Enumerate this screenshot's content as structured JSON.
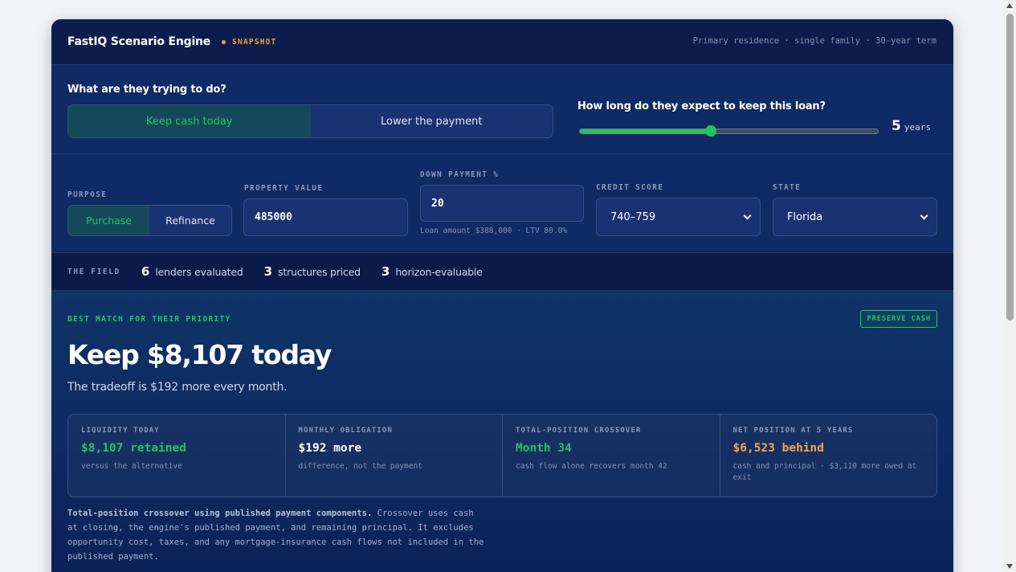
{
  "header": {
    "brand": "FastIQ Scenario Engine",
    "snapshot": "SNAPSHOT",
    "meta": "Primary residence · single family · 30-year term"
  },
  "intent": {
    "question": "What are they trying to do?",
    "options": [
      "Keep cash today",
      "Lower the payment"
    ],
    "selected": "Keep cash today",
    "horizon_question": "How long do they expect to keep this loan?",
    "horizon_value": "5",
    "horizon_unit": "years",
    "horizon_fraction": 0.44
  },
  "inputs": {
    "purpose_label": "PURPOSE",
    "purpose_options": [
      "Purchase",
      "Refinance"
    ],
    "purpose_selected": "Purchase",
    "property_label": "PROPERTY VALUE",
    "property_value": "485000",
    "down_label": "DOWN PAYMENT %",
    "down_value": "20",
    "down_note": "Loan amount $388,000 · LTV 80.0%",
    "credit_label": "CREDIT SCORE",
    "credit_value": "740–759",
    "state_label": "STATE",
    "state_value": "Florida"
  },
  "field": {
    "tag": "THE FIELD",
    "stats": [
      {
        "num": "6",
        "text": "lenders evaluated"
      },
      {
        "num": "3",
        "text": "structures priced"
      },
      {
        "num": "3",
        "text": "horizon-evaluable"
      }
    ]
  },
  "result": {
    "tag": "BEST MATCH FOR THEIR PRIORITY",
    "badge": "PRESERVE CASH",
    "headline": "Keep $8,107 today",
    "subline": "The tradeoff is $192 more every month.",
    "metrics": [
      {
        "label": "LIQUIDITY TODAY",
        "value": "$8,107 retained",
        "sub": "versus the alternative",
        "color": "#22c55e"
      },
      {
        "label": "MONTHLY OBLIGATION",
        "value": "$192 more",
        "sub": "difference, not the payment",
        "color": "#ffffff"
      },
      {
        "label": "TOTAL-POSITION CROSSOVER",
        "value": "Month 34",
        "sub": "cash flow alone recovers month 42",
        "color": "#22c55e"
      },
      {
        "label": "NET POSITION AT 5 YEARS",
        "value": "$6,523 behind",
        "sub": "cash and principal · $3,110 more owed at exit",
        "color": "#f5a54a"
      }
    ],
    "foot_bold": "Total-position crossover using published payment components.",
    "foot_text": " Crossover uses cash at closing, the engine's published payment, and remaining principal. It excludes opportunity cost, taxes, and any mortgage-insurance cash flows not included in the published payment."
  }
}
